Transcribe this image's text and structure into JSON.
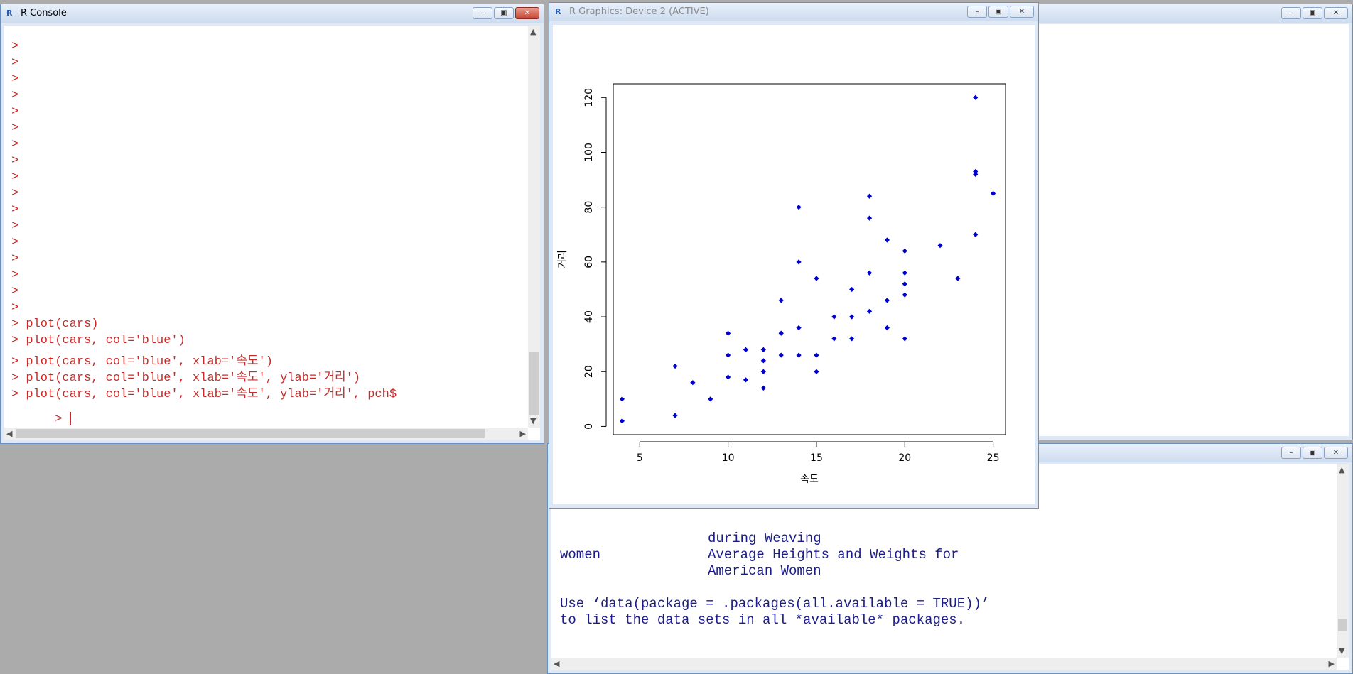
{
  "console": {
    "title": "R Console",
    "empty_prompts": [
      ">",
      ">",
      ">",
      ">",
      ">",
      ">",
      ">",
      ">",
      ">",
      ">",
      ">",
      ">",
      ">",
      ">",
      ">",
      ">",
      ">"
    ],
    "commands": [
      "> plot(cars)",
      "> plot(cars, col='blue')",
      "> plot(cars, col='blue', xlab='속도')",
      "> plot(cars, col='blue', xlab='속도', ylab='거리')",
      "> plot(cars, col='blue', xlab='속도', ylab='거리', pch$"
    ],
    "current_prompt": "> ",
    "text_color": "#cc2a2a"
  },
  "graphics": {
    "title": "R Graphics: Device 2 (ACTIVE)"
  },
  "help": {
    "lines": [
      {
        "col1": "",
        "col2": "during Weaving"
      },
      {
        "col1": "women",
        "col2": "Average Heights and Weights for"
      },
      {
        "col1": "",
        "col2": "American Women"
      },
      {
        "col1": "Use ‘data(package = .packages(all.available = TRUE))’",
        "col2": ""
      },
      {
        "col1": "to list the data sets in all *available* packages.",
        "col2": ""
      }
    ]
  },
  "icons": {
    "minimize": "minimize-icon",
    "maximize": "maximize-icon",
    "close": "close-icon",
    "r_logo": "r-logo-icon"
  },
  "window_controls": {
    "minimize": "–",
    "maximize": "▣",
    "close": "✕",
    "r_logo": "R"
  },
  "chart_data": {
    "type": "scatter",
    "xlabel": "속도",
    "ylabel": "거리",
    "xlim": [
      3.5,
      25.7
    ],
    "ylim": [
      -3,
      125
    ],
    "x_ticks": [
      5,
      10,
      15,
      20,
      25
    ],
    "y_ticks": [
      0,
      20,
      40,
      60,
      80,
      100,
      120
    ],
    "color": "#0000cc",
    "grid": false,
    "points": {
      "x": [
        4,
        4,
        7,
        7,
        8,
        9,
        10,
        10,
        10,
        11,
        11,
        12,
        12,
        12,
        12,
        13,
        13,
        13,
        13,
        14,
        14,
        14,
        14,
        15,
        15,
        15,
        16,
        16,
        17,
        17,
        17,
        18,
        18,
        18,
        18,
        19,
        19,
        19,
        20,
        20,
        20,
        20,
        20,
        22,
        23,
        24,
        24,
        24,
        24,
        25
      ],
      "y": [
        2,
        10,
        4,
        22,
        16,
        10,
        18,
        26,
        34,
        17,
        28,
        14,
        20,
        24,
        28,
        26,
        34,
        34,
        46,
        26,
        36,
        60,
        80,
        20,
        26,
        54,
        32,
        40,
        32,
        40,
        50,
        42,
        56,
        76,
        84,
        36,
        46,
        68,
        32,
        48,
        52,
        56,
        64,
        66,
        54,
        70,
        92,
        93,
        120,
        85
      ]
    }
  }
}
